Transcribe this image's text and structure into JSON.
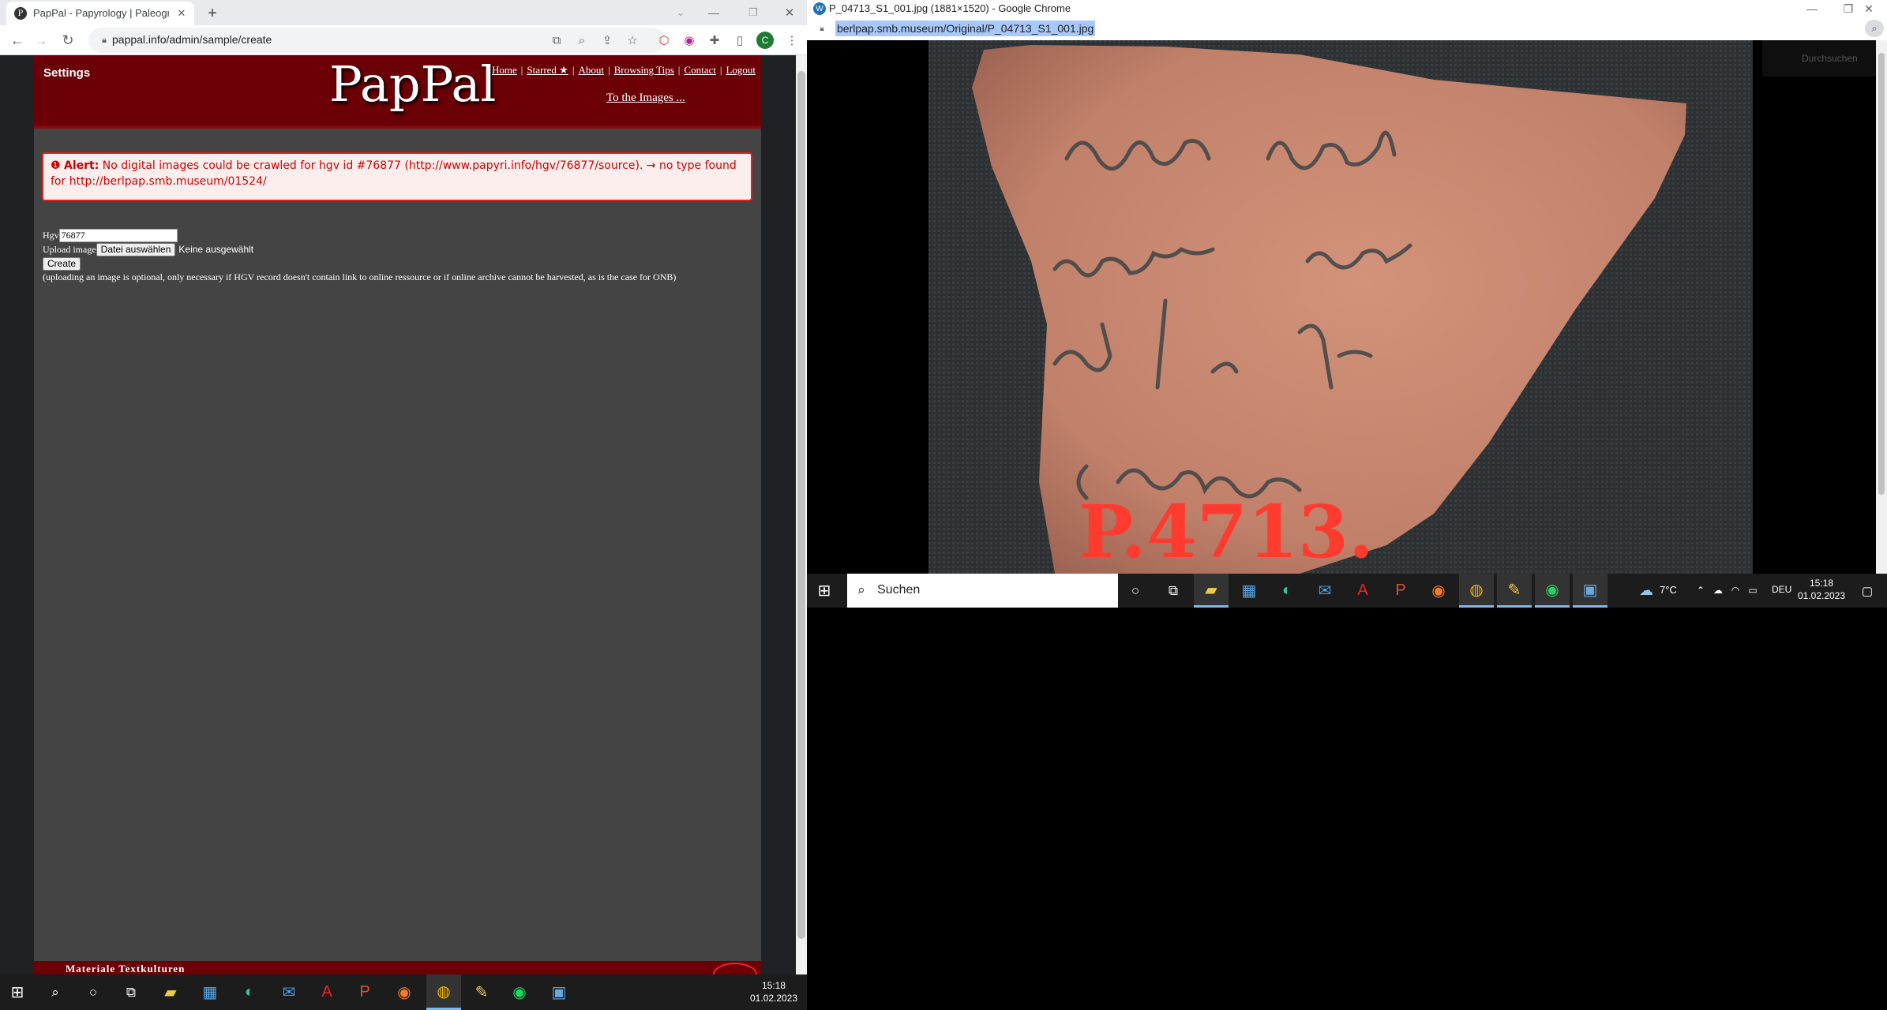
{
  "left_browser": {
    "tab_title": "PapPal - Papyrology | Paleograph",
    "new_tab": "+",
    "url": "pappal.info/admin/sample/create",
    "profile_letter": "C"
  },
  "site": {
    "settings": "Settings",
    "logo": "PapPal",
    "nav": [
      "Home",
      "Starred ★",
      "About",
      "Browsing Tips",
      "Contact",
      "Logout"
    ],
    "to_images": "To the Images ...",
    "alert_label": "Alert:",
    "alert_text": "No digital images could be crawled for hgv id #76877 (http://www.papyri.info/hgv/76877/source). → no type found for http://berlpap.smb.museum/01524/",
    "hgv_label": "Hgv",
    "hgv_value": "76877",
    "upload_label": "Upload image",
    "file_button": "Datei auswählen",
    "file_status": "Keine ausgewählt",
    "create_button": "Create",
    "note": "(uploading an image is optional, only necessary if HGV record doesn't contain link to online ressource or if online archive cannot be harvested, as is the case for ONB)",
    "footer": "Materiale Textkulturen"
  },
  "left_taskbar": {
    "time": "15:18",
    "date": "01.02.2023"
  },
  "right_browser": {
    "window_title": "P_04713_S1_001.jpg (1881×1520) - Google Chrome",
    "url": "berlpap.smb.museum/Original/P_04713_S1_001.jpg",
    "overlay_text": "Durchsuchen",
    "inventory_mark": "P.4713."
  },
  "right_taskbar": {
    "search_placeholder": "Suchen",
    "weather": "7°C",
    "lang": "DEU",
    "time": "15:18",
    "date": "01.02.2023"
  },
  "colors": {
    "header_red": "#6b0006",
    "page_grey": "#444444",
    "alert_red": "#cc0000"
  }
}
